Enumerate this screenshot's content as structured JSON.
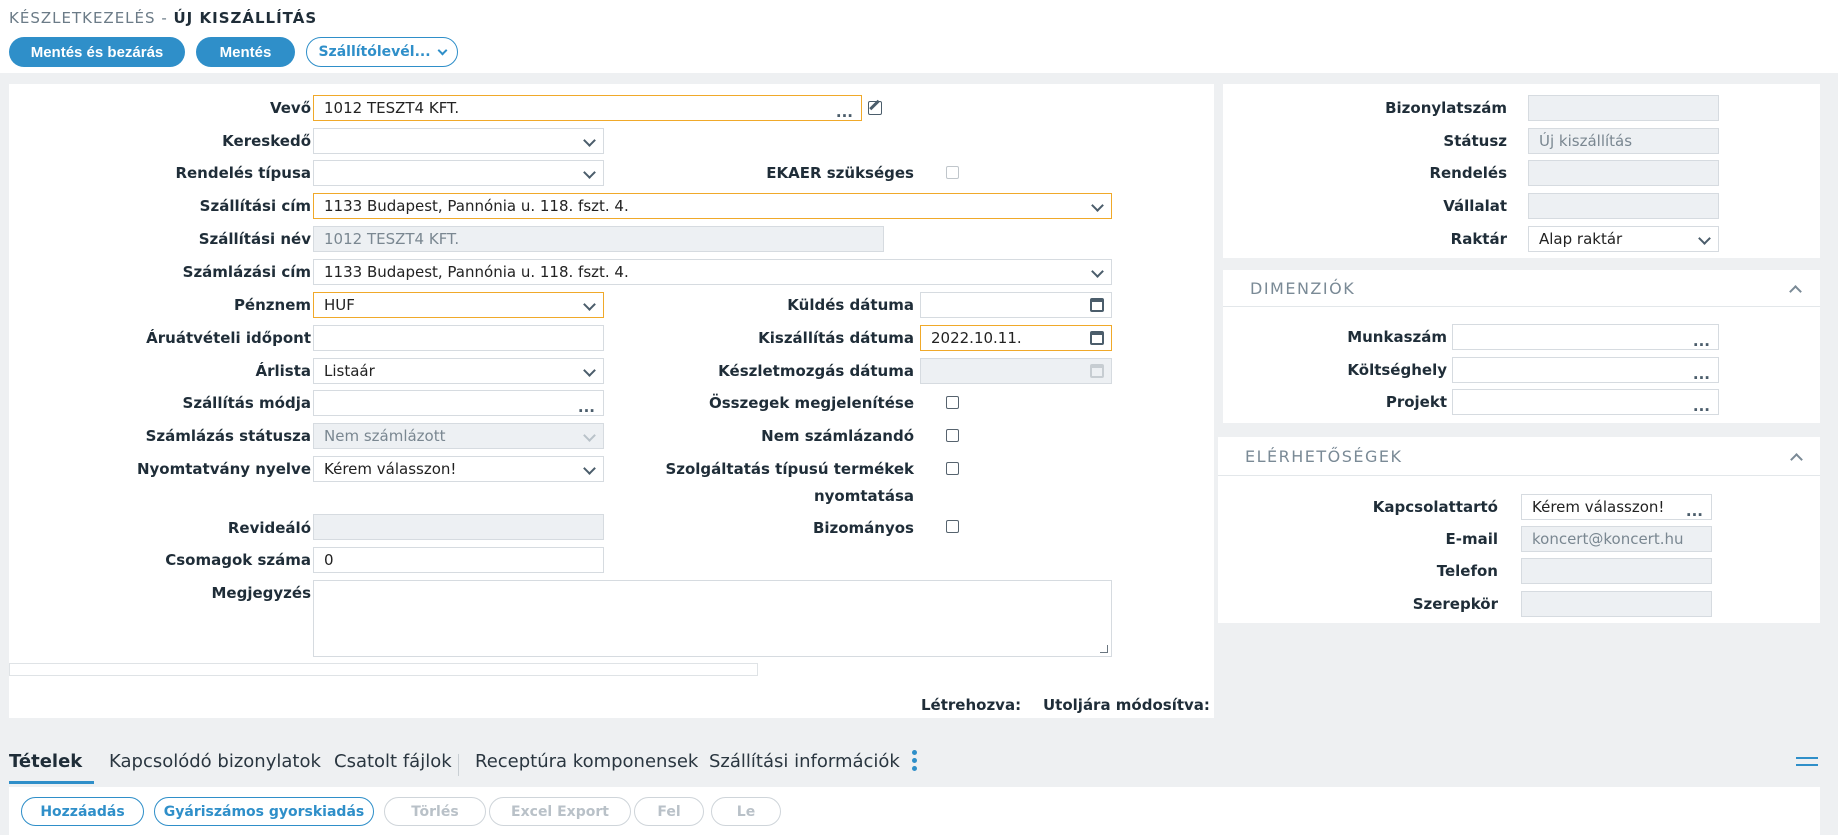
{
  "breadcrumb": {
    "module": "KÉSZLETKEZELÉS",
    "separator": " - ",
    "current": "ÚJ KISZÁLLÍTÁS"
  },
  "toolbar": {
    "save_close": "Mentés és bezárás",
    "save": "Mentés",
    "delivery_note": "Szállítólevél..."
  },
  "form": {
    "customer": {
      "label": "Vevő",
      "value": "1012 TESZT4 KFT."
    },
    "dealer": {
      "label": "Kereskedő",
      "value": ""
    },
    "order_type": {
      "label": "Rendelés típusa",
      "value": ""
    },
    "ekaer": {
      "label": "EKAER szükséges"
    },
    "shipping_address": {
      "label": "Szállítási cím",
      "value": "1133 Budapest, Pannónia u. 118. fszt. 4."
    },
    "shipping_name": {
      "label": "Szállítási név",
      "value": "1012 TESZT4 KFT."
    },
    "billing_address": {
      "label": "Számlázási cím",
      "value": "1133 Budapest, Pannónia u. 118. fszt. 4."
    },
    "currency": {
      "label": "Pénznem",
      "value": "HUF"
    },
    "send_date": {
      "label": "Küldés dátuma",
      "value": ""
    },
    "receipt_time": {
      "label": "Áruátvételi időpont",
      "value": ""
    },
    "delivery_date": {
      "label": "Kiszállítás dátuma",
      "value": "2022.10.11."
    },
    "price_list": {
      "label": "Árlista",
      "value": "Listaár"
    },
    "stock_move_date": {
      "label": "Készletmozgás dátuma",
      "value": ""
    },
    "shipping_method": {
      "label": "Szállítás módja",
      "value": ""
    },
    "show_amounts": {
      "label": "Összegek megjelenítése"
    },
    "billing_status": {
      "label": "Számlázás státusza",
      "value": "Nem számlázott"
    },
    "not_billable": {
      "label": "Nem számlázandó"
    },
    "print_language": {
      "label": "Nyomtatvány nyelve",
      "value": "Kérem válasszon!"
    },
    "service_print": {
      "label_line1": "Szolgáltatás típusú termékek",
      "label_line2": "nyomtatása"
    },
    "reviewer": {
      "label": "Revideáló",
      "value": ""
    },
    "consignment": {
      "label": "Bizományos"
    },
    "packages": {
      "label": "Csomagok száma",
      "value": "0"
    },
    "note": {
      "label": "Megjegyzés",
      "value": ""
    },
    "created_label": "Létrehozva:",
    "modified_label": "Utoljára módosítva:"
  },
  "doc_info": {
    "doc_number": {
      "label": "Bizonylatszám",
      "value": ""
    },
    "status": {
      "label": "Státusz",
      "value": "Új kiszállítás"
    },
    "order": {
      "label": "Rendelés",
      "value": ""
    },
    "company": {
      "label": "Vállalat",
      "value": ""
    },
    "warehouse": {
      "label": "Raktár",
      "value": "Alap raktár"
    }
  },
  "dimensions": {
    "title": "DIMENZIÓK",
    "work_number": {
      "label": "Munkaszám",
      "value": ""
    },
    "cost_center": {
      "label": "Költséghely",
      "value": ""
    },
    "project": {
      "label": "Projekt",
      "value": ""
    }
  },
  "contacts": {
    "title": "ELÉRHETŐSÉGEK",
    "contact_person": {
      "label": "Kapcsolattartó",
      "value": "Kérem válasszon!"
    },
    "email": {
      "label": "E-mail",
      "value": "koncert@koncert.hu"
    },
    "phone": {
      "label": "Telefon",
      "value": ""
    },
    "role": {
      "label": "Szerepkör",
      "value": ""
    }
  },
  "tabs": [
    "Tételek",
    "Kapcsolódó bizonylatok",
    "Csatolt fájlok",
    "Receptúra komponensek",
    "Szállítási információk"
  ],
  "items_toolbar": {
    "add": "Hozzáadás",
    "serial_quick": "Gyáriszámos gyorskiadás",
    "delete": "Törlés",
    "excel": "Excel Export",
    "up": "Fel",
    "down": "Le"
  },
  "colors": {
    "accent": "#2f8fc9",
    "required_border": "#f0a92a",
    "readonly_bg": "#edf0f3"
  }
}
